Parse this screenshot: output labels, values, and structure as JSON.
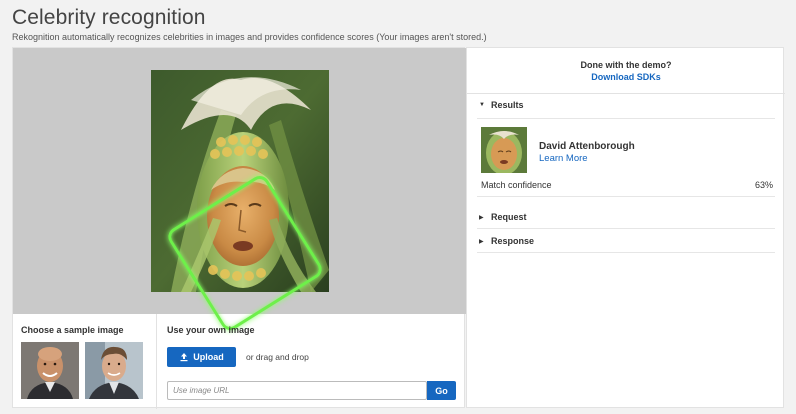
{
  "header": {
    "title": "Celebrity recognition",
    "subtitle": "Rekognition automatically recognizes celebrities in images and provides confidence scores (Your images aren't stored.)"
  },
  "samples": {
    "label": "Choose a sample image"
  },
  "own_image": {
    "label": "Use your own image",
    "upload_label": "Upload",
    "drag_text": "or drag and drop",
    "url_placeholder": "Use image URL",
    "go_label": "Go"
  },
  "sidebar": {
    "done_text": "Done with the demo?",
    "sdk_link": "Download SDKs",
    "results_label": "Results",
    "result": {
      "name": "David Attenborough",
      "learn_more": "Learn More",
      "match_label": "Match confidence",
      "match_value": "63%"
    },
    "request_label": "Request",
    "response_label": "Response"
  },
  "colors": {
    "accent": "#1667c0",
    "detection_box": "#6ef04a"
  },
  "icons": {
    "upload": "upload-icon",
    "caret_expanded": "caret-down-icon",
    "caret_collapsed": "caret-right-icon"
  }
}
